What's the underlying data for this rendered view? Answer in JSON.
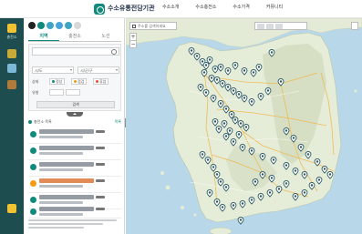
{
  "header": {
    "logo": {
      "title": "수소유통전담기관",
      "subtitle": ""
    },
    "nav": [
      "수소소개",
      "수소충전소",
      "수소가격",
      "커뮤니티"
    ]
  },
  "leftbar": {
    "items": [
      {
        "label": "충전소",
        "icon": "station-icon",
        "selected": true
      },
      {
        "label": "",
        "icon": "pin-icon",
        "selected": false
      },
      {
        "label": "",
        "icon": "truck-icon",
        "selected": false
      },
      {
        "label": "",
        "icon": "box-icon",
        "selected": false
      },
      {
        "label": "",
        "icon": "info-icon",
        "selected": false
      }
    ]
  },
  "panel": {
    "tabs": [
      "지역",
      "충전소",
      "노선"
    ],
    "active_tab": 0,
    "status_circles": [
      "#222222",
      "#0f8a7c",
      "#3fa5c4",
      "#4aa3df",
      "#3fa5c4",
      "#d8d8d8"
    ],
    "filters": {
      "label_state": "상태",
      "label_type": "유형",
      "label_option": "옵션",
      "select_1": "시/도",
      "select_2": "시/군/구",
      "chip_normal": "정상",
      "chip_check": "점검",
      "chip_closed": "휴업",
      "search_button": "검색"
    },
    "list_header": {
      "title": "충전소 목록",
      "right": "목록"
    },
    "stations": [
      {
        "state": "normal"
      },
      {
        "state": "normal"
      },
      {
        "state": "normal"
      },
      {
        "state": "closed"
      },
      {
        "state": "normal"
      },
      {
        "state": "normal"
      }
    ]
  },
  "map": {
    "search_placeholder": "주소를 검색하세요",
    "zoom_in": "+",
    "zoom_out": "−",
    "land_color": "#e3ead6",
    "sea_color": "#b8d7e9",
    "marker_color": "#2f5c63"
  }
}
